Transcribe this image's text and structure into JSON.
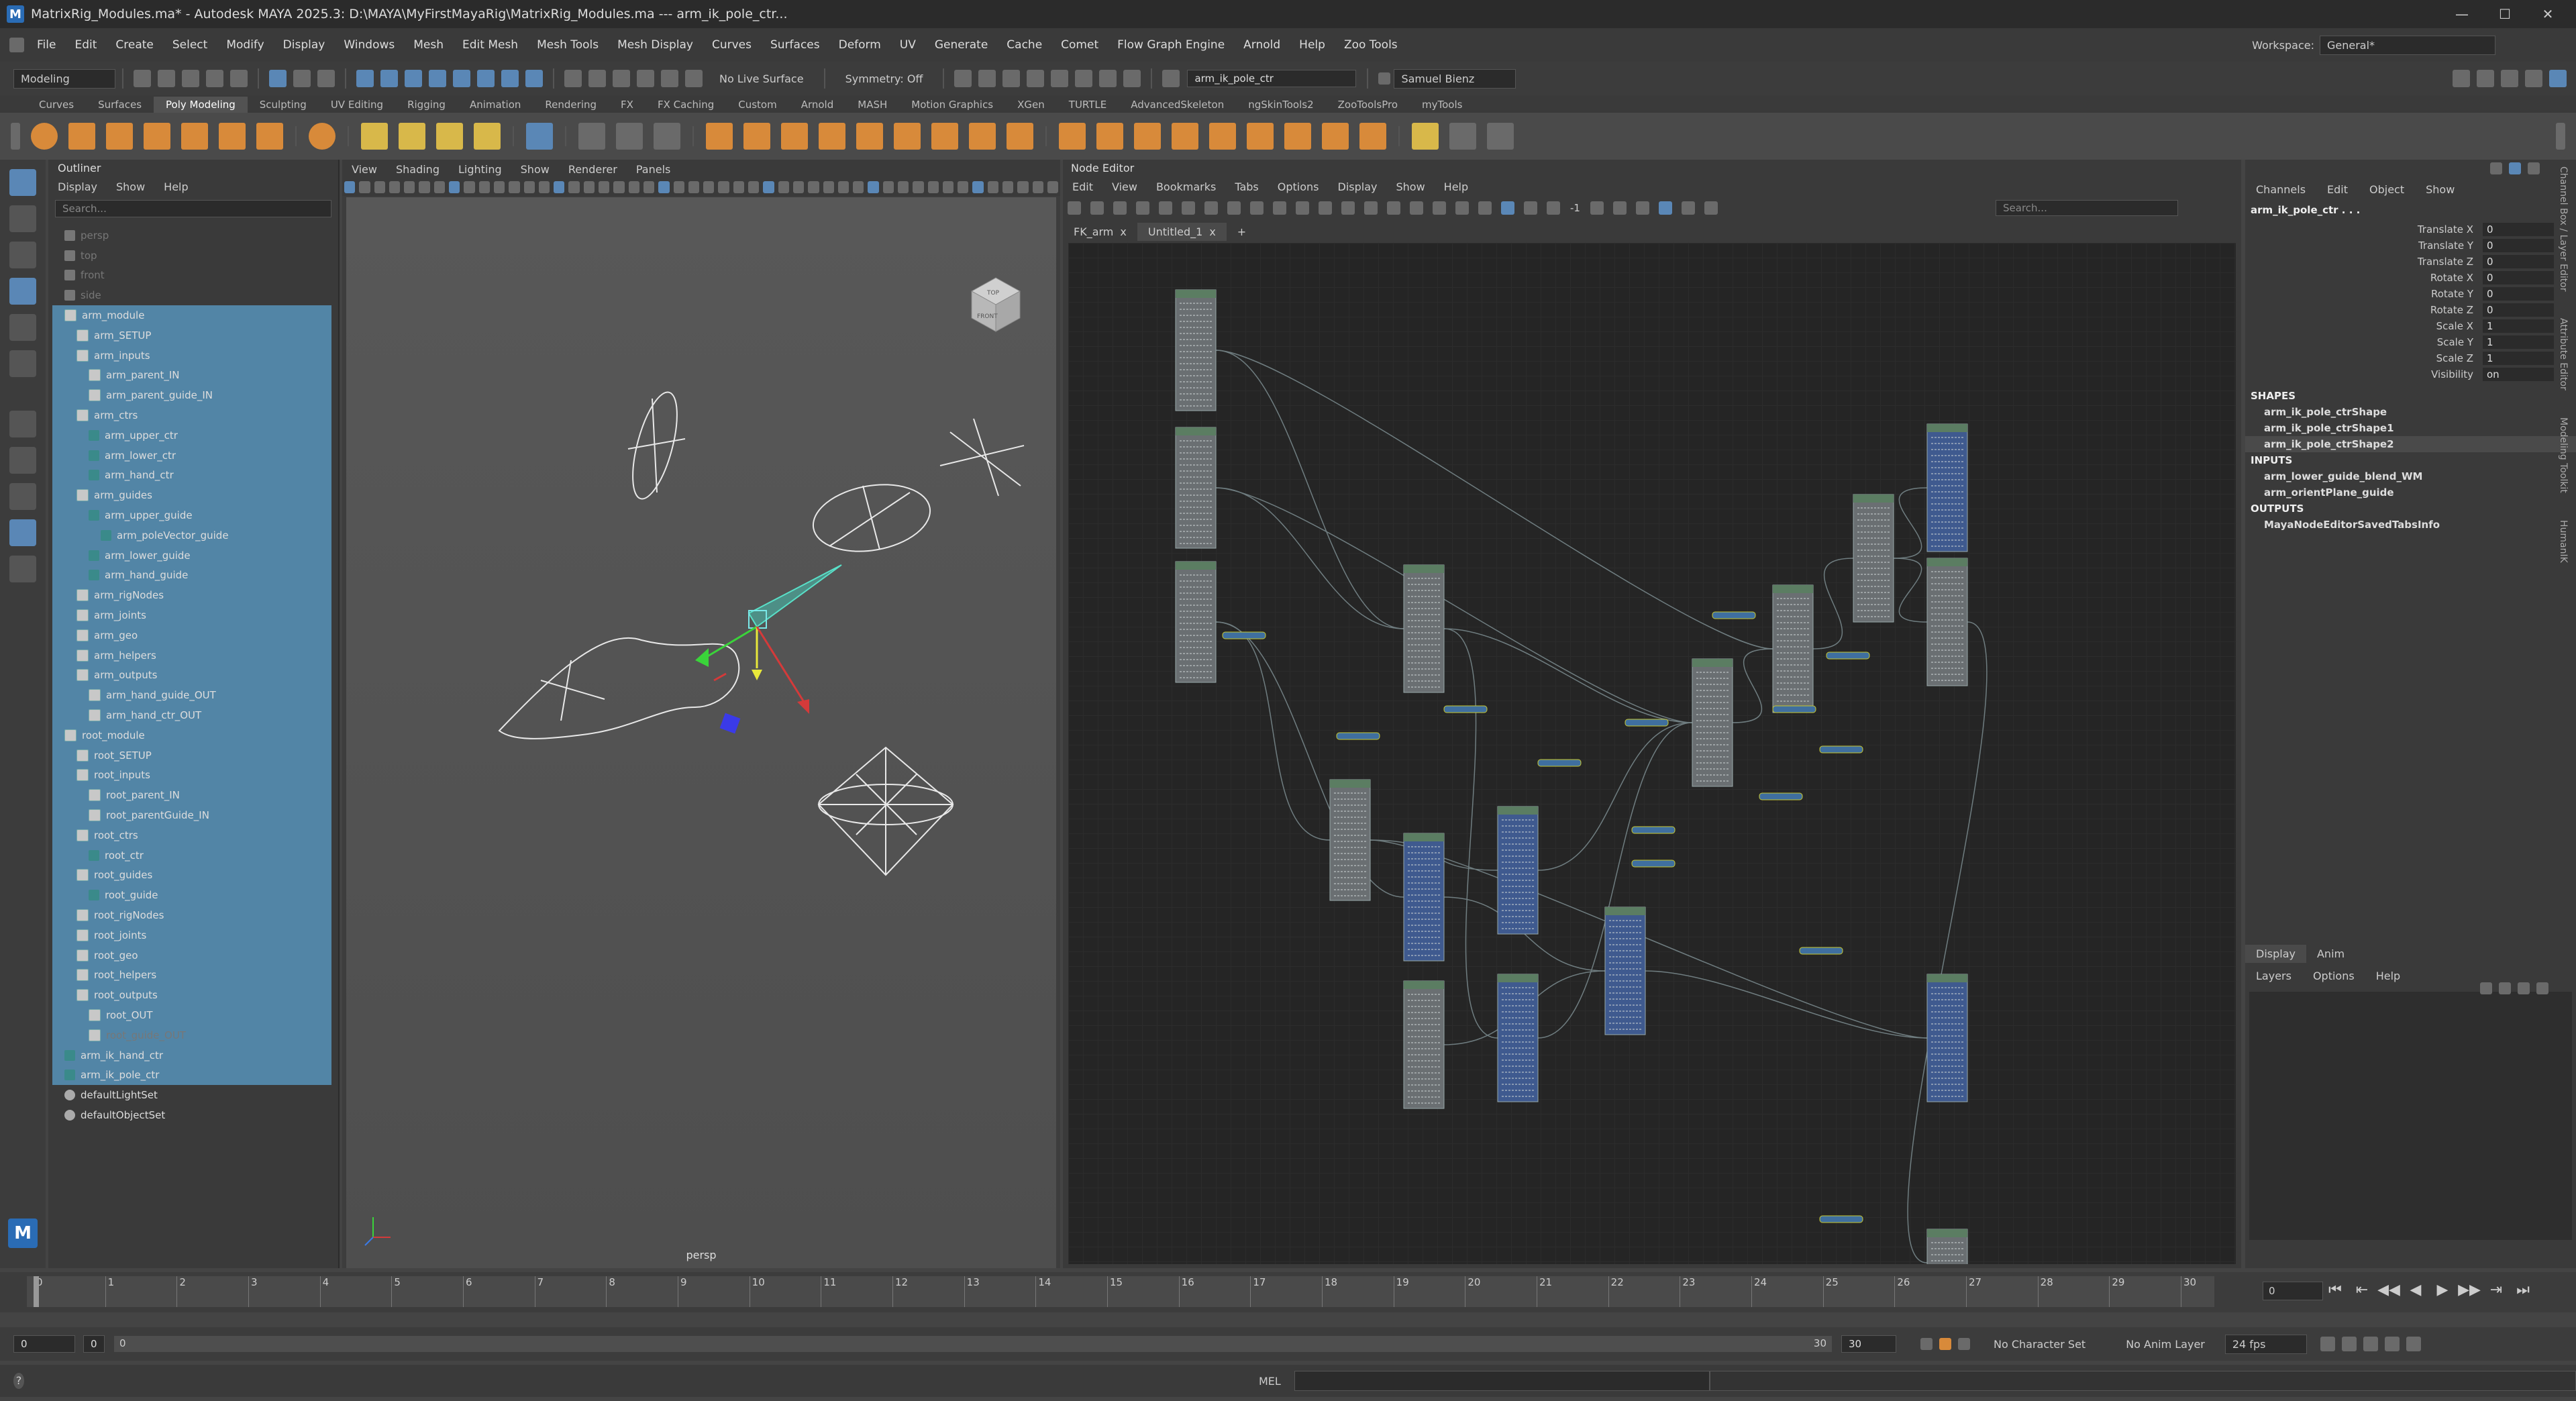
{
  "title_bar": {
    "title": "MatrixRig_Modules.ma* - Autodesk MAYA 2025.3: D:\\MAYA\\MyFirstMayaRig\\MatrixRig_Modules.ma  ---  arm_ik_pole_ctr...",
    "minimize": "—",
    "maximize": "☐",
    "close": "✕"
  },
  "menu_bar": {
    "items": [
      "File",
      "Edit",
      "Create",
      "Select",
      "Modify",
      "Display",
      "Windows",
      "Mesh",
      "Edit Mesh",
      "Mesh Tools",
      "Mesh Display",
      "Curves",
      "Surfaces",
      "Deform",
      "UV",
      "Generate",
      "Cache",
      "Comet",
      "Flow Graph Engine",
      "Arnold",
      "Help",
      "Zoo Tools"
    ],
    "workspace_label": "Workspace:",
    "workspace_value": "General*"
  },
  "status_line": {
    "mode": "Modeling",
    "live_surface": "No Live Surface",
    "symmetry": "Symmetry: Off",
    "object_name": "arm_ik_pole_ctr",
    "user": "Samuel Bienz"
  },
  "shelf": {
    "tabs": [
      "Curves",
      "Surfaces",
      "Poly Modeling",
      "Sculpting",
      "UV Editing",
      "Rigging",
      "Animation",
      "Rendering",
      "FX",
      "FX Caching",
      "Custom",
      "Arnold",
      "MASH",
      "Motion Graphics",
      "XGen",
      "TURTLE",
      "AdvancedSkeleton",
      "ngSkinTools2",
      "ZooToolsPro",
      "myTools"
    ],
    "active_tab": "Poly Modeling"
  },
  "outliner": {
    "header": "Outliner",
    "menus": [
      "Display",
      "Show",
      "Help"
    ],
    "search_placeholder": "Search...",
    "rows": [
      {
        "label": "persp",
        "indent": 1,
        "icon": "cam",
        "selected": false,
        "dim": true
      },
      {
        "label": "top",
        "indent": 1,
        "icon": "cam",
        "selected": false,
        "dim": true
      },
      {
        "label": "front",
        "indent": 1,
        "icon": "cam",
        "selected": false,
        "dim": true
      },
      {
        "label": "side",
        "indent": 1,
        "icon": "cam",
        "selected": false,
        "dim": true
      },
      {
        "label": "arm_module",
        "indent": 1,
        "icon": "grp",
        "selected": true,
        "dim": false
      },
      {
        "label": "arm_SETUP",
        "indent": 2,
        "icon": "grp",
        "selected": true,
        "dim": false
      },
      {
        "label": "arm_inputs",
        "indent": 2,
        "icon": "grp",
        "selected": true,
        "dim": false
      },
      {
        "label": "arm_parent_IN",
        "indent": 3,
        "icon": "grp",
        "selected": true,
        "dim": false
      },
      {
        "label": "arm_parent_guide_IN",
        "indent": 3,
        "icon": "grp",
        "selected": true,
        "dim": false
      },
      {
        "label": "arm_ctrs",
        "indent": 2,
        "icon": "grp",
        "selected": true,
        "dim": false
      },
      {
        "label": "arm_upper_ctr",
        "indent": 3,
        "icon": "crv",
        "selected": true,
        "dim": false
      },
      {
        "label": "arm_lower_ctr",
        "indent": 3,
        "icon": "crv",
        "selected": true,
        "dim": false
      },
      {
        "label": "arm_hand_ctr",
        "indent": 3,
        "icon": "crv",
        "selected": true,
        "dim": false
      },
      {
        "label": "arm_guides",
        "indent": 2,
        "icon": "grp",
        "selected": true,
        "dim": false
      },
      {
        "label": "arm_upper_guide",
        "indent": 3,
        "icon": "crv",
        "selected": true,
        "dim": false
      },
      {
        "label": "arm_poleVector_guide",
        "indent": 4,
        "icon": "crv",
        "selected": true,
        "dim": false
      },
      {
        "label": "arm_lower_guide",
        "indent": 3,
        "icon": "crv",
        "selected": true,
        "dim": false
      },
      {
        "label": "arm_hand_guide",
        "indent": 3,
        "icon": "crv",
        "selected": true,
        "dim": false
      },
      {
        "label": "arm_rigNodes",
        "indent": 2,
        "icon": "grp",
        "selected": true,
        "dim": false
      },
      {
        "label": "arm_joints",
        "indent": 2,
        "icon": "grp",
        "selected": true,
        "dim": false
      },
      {
        "label": "arm_geo",
        "indent": 2,
        "icon": "grp",
        "selected": true,
        "dim": false
      },
      {
        "label": "arm_helpers",
        "indent": 2,
        "icon": "grp",
        "selected": true,
        "dim": false
      },
      {
        "label": "arm_outputs",
        "indent": 2,
        "icon": "grp",
        "selected": true,
        "dim": false
      },
      {
        "label": "arm_hand_guide_OUT",
        "indent": 3,
        "icon": "grp",
        "selected": true,
        "dim": false
      },
      {
        "label": "arm_hand_ctr_OUT",
        "indent": 3,
        "icon": "grp",
        "selected": true,
        "dim": false
      },
      {
        "label": "root_module",
        "indent": 1,
        "icon": "grp",
        "selected": true,
        "dim": false
      },
      {
        "label": "root_SETUP",
        "indent": 2,
        "icon": "grp",
        "selected": true,
        "dim": false
      },
      {
        "label": "root_inputs",
        "indent": 2,
        "icon": "grp",
        "selected": true,
        "dim": false
      },
      {
        "label": "root_parent_IN",
        "indent": 3,
        "icon": "grp",
        "selected": true,
        "dim": false
      },
      {
        "label": "root_parentGuide_IN",
        "indent": 3,
        "icon": "grp",
        "selected": true,
        "dim": false
      },
      {
        "label": "root_ctrs",
        "indent": 2,
        "icon": "grp",
        "selected": true,
        "dim": false
      },
      {
        "label": "root_ctr",
        "indent": 3,
        "icon": "crv",
        "selected": true,
        "dim": false
      },
      {
        "label": "root_guides",
        "indent": 2,
        "icon": "grp",
        "selected": true,
        "dim": false
      },
      {
        "label": "root_guide",
        "indent": 3,
        "icon": "crv",
        "selected": true,
        "dim": false
      },
      {
        "label": "root_rigNodes",
        "indent": 2,
        "icon": "grp",
        "selected": true,
        "dim": false
      },
      {
        "label": "root_joints",
        "indent": 2,
        "icon": "grp",
        "selected": true,
        "dim": false
      },
      {
        "label": "root_geo",
        "indent": 2,
        "icon": "grp",
        "selected": true,
        "dim": false
      },
      {
        "label": "root_helpers",
        "indent": 2,
        "icon": "grp",
        "selected": true,
        "dim": false
      },
      {
        "label": "root_outputs",
        "indent": 2,
        "icon": "grp",
        "selected": true,
        "dim": false
      },
      {
        "label": "root_OUT",
        "indent": 3,
        "icon": "grp",
        "selected": true,
        "dim": false
      },
      {
        "label": "root_guide_OUT",
        "indent": 3,
        "icon": "grp",
        "selected": true,
        "dim": true
      },
      {
        "label": "arm_ik_hand_ctr",
        "indent": 1,
        "icon": "crv",
        "selected": true,
        "dim": false
      },
      {
        "label": "arm_ik_pole_ctr",
        "indent": 1,
        "icon": "crv",
        "selected": true,
        "dim": false
      },
      {
        "label": "defaultLightSet",
        "indent": 1,
        "icon": "set",
        "selected": false,
        "dim": false
      },
      {
        "label": "defaultObjectSet",
        "indent": 1,
        "icon": "set",
        "selected": false,
        "dim": false
      }
    ]
  },
  "viewport": {
    "menus": [
      "View",
      "Shading",
      "Lighting",
      "Show",
      "Renderer",
      "Panels"
    ],
    "camera_label": "persp",
    "viewcube_labels": [
      "TOP",
      "FRONT"
    ]
  },
  "node_editor": {
    "title": "Node Editor",
    "menus": [
      "Edit",
      "View",
      "Bookmarks",
      "Tabs",
      "Options",
      "Display",
      "Show",
      "Help"
    ],
    "search_placeholder": "Search...",
    "tabs": [
      {
        "label": "FK_arm",
        "close": "x"
      },
      {
        "label": "Untitled_1",
        "close": "x"
      },
      {
        "label": "+",
        "close": ""
      }
    ],
    "active_tab": "Untitled_1",
    "toolbar_value": "-1"
  },
  "channel_box": {
    "menus": [
      "Channels",
      "Edit",
      "Object",
      "Show"
    ],
    "object_name": "arm_ik_pole_ctr . . .",
    "attributes": [
      {
        "name": "Translate X",
        "value": "0"
      },
      {
        "name": "Translate Y",
        "value": "0"
      },
      {
        "name": "Translate Z",
        "value": "0"
      },
      {
        "name": "Rotate X",
        "value": "0"
      },
      {
        "name": "Rotate Y",
        "value": "0"
      },
      {
        "name": "Rotate Z",
        "value": "0"
      },
      {
        "name": "Scale X",
        "value": "1"
      },
      {
        "name": "Scale Y",
        "value": "1"
      },
      {
        "name": "Scale Z",
        "value": "1"
      },
      {
        "name": "Visibility",
        "value": "on"
      }
    ],
    "shapes_header": "SHAPES",
    "shapes": [
      "arm_ik_pole_ctrShape",
      "arm_ik_pole_ctrShape1",
      "arm_ik_pole_ctrShape2"
    ],
    "inputs_header": "INPUTS",
    "inputs": [
      "arm_lower_guide_blend_WM",
      "arm_orientPlane_guide"
    ],
    "outputs_header": "OUTPUTS",
    "outputs": [
      "MayaNodeEditorSavedTabsInfo"
    ],
    "side_tabs": [
      "Channel Box / Layer Editor",
      "Attribute Editor",
      "Modeling Toolkit",
      "HumanIK"
    ]
  },
  "layer_editor": {
    "tabs": [
      "Display",
      "Anim"
    ],
    "active_tab": "Display",
    "menus": [
      "Layers",
      "Options",
      "Help"
    ]
  },
  "time_slider": {
    "ticks": [
      "0",
      "1",
      "2",
      "3",
      "4",
      "5",
      "6",
      "7",
      "8",
      "9",
      "10",
      "11",
      "12",
      "13",
      "14",
      "15",
      "16",
      "17",
      "18",
      "19",
      "20",
      "21",
      "22",
      "23",
      "24",
      "25",
      "26",
      "27",
      "28",
      "29",
      "30"
    ],
    "current_frame": "0",
    "playback_buttons": [
      "⏮",
      "⇤",
      "◀◀",
      "◀",
      "▶",
      "▶▶",
      "⇥",
      "⏭"
    ]
  },
  "range_slider": {
    "start": "0",
    "range_start": "0",
    "range_start_inner": "0",
    "range_end_inner": "30",
    "range_end": "30",
    "character_set": "No Character Set",
    "anim_layer": "No Anim Layer",
    "fps": "24 fps"
  },
  "command_line": {
    "language": "MEL",
    "help_icon": "?"
  },
  "node_graph": {
    "node_count_left_col": 3,
    "connection_color": "#6f7d80",
    "node_header_color": "#5b7d62",
    "node_body_color": "#6a6f72",
    "blue_node_color": "#3f5a8f"
  }
}
